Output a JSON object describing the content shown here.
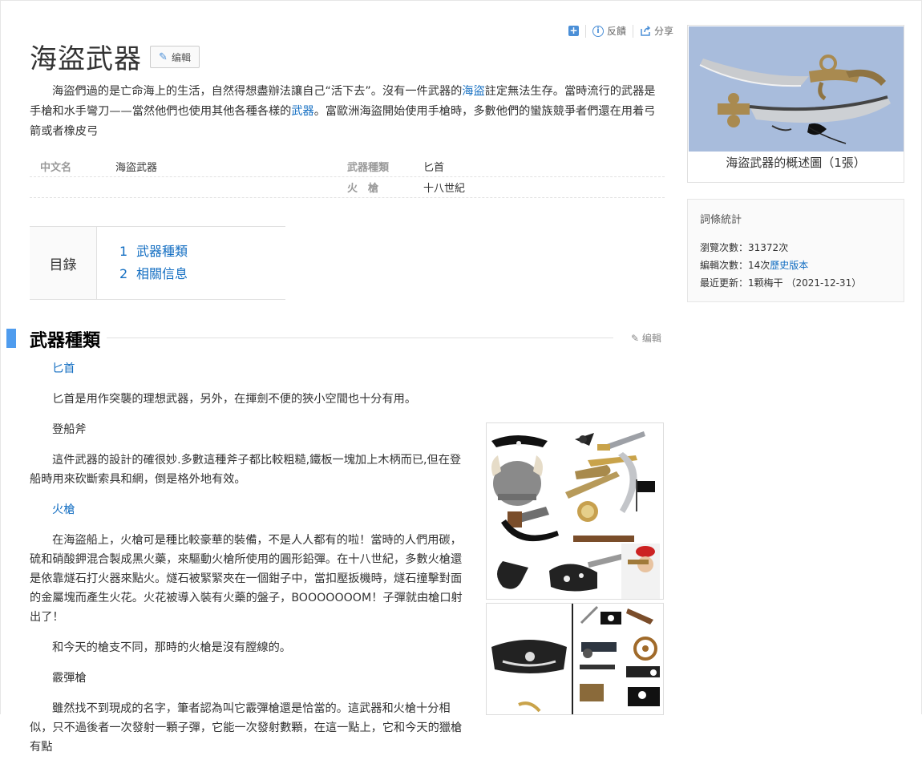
{
  "toolbar": {
    "add_icon": "plus-square-icon",
    "feedback_label": "反饋",
    "share_label": "分享"
  },
  "title": "海盜武器",
  "edit_label": "编輯",
  "intro": {
    "before_link1": "海盜們過的是亡命海上的生活，自然得想盡辦法讓自己“活下去”。沒有一件武器的",
    "link1": "海盜",
    "between": "註定無法生存。當時流行的武器是手槍和水手彎刀——當然他們也使用其他各種各樣的",
    "link2": "武器",
    "after": "。富歐洲海盜開始使用手槍時，多數他們的蠻族競爭者們還在用着弓箭或者橡皮弓"
  },
  "basic_info": {
    "row1": {
      "k1": "中文名",
      "v1": "海盜武器",
      "k2": "武器種類",
      "v2": "匕首"
    },
    "row2": {
      "k2": "火　槍",
      "v2": "十八世紀"
    }
  },
  "toc": {
    "label": "目錄",
    "items": [
      {
        "num": "1",
        "label": "武器種類"
      },
      {
        "num": "2",
        "label": "相關信息"
      }
    ]
  },
  "section": {
    "title": "武器種類",
    "edit_label": "编輯"
  },
  "body": {
    "h1": "匕首",
    "p1": "匕首是用作突襲的理想武器，另外，在揮劍不便的狹小空間也十分有用。",
    "h2": "登船斧",
    "p2": "這件武器的設計的確很妙.多數這種斧子都比較粗糙,鐵板一塊加上木柄而已,但在登船時用來砍斷索具和網，倒是格外地有效。",
    "h3": "火槍",
    "p3": "在海盜船上，火槍可是種比較豪華的裝備，不是人人都有的啦！當時的人們用碳，硫和硝酸鉀混合製成黑火藥，來驅動火槍所使用的圓形鉛彈。在十八世紀，多數火槍還是依靠燧石打火器來點火。燧石被緊緊夾在一個鉗子中，當扣壓扳機時，燧石撞擊對面的金屬塊而產生火花。火花被導入裝有火藥的盤子，BOOOOOOOM！子彈就由槍口射出了！",
    "p4": "和今天的槍支不同，那時的火槍是沒有膛線的。",
    "h5": "霰彈槍",
    "p5": "雖然找不到現成的名字，筆者認為叫它霰彈槍還是恰當的。這武器和火槍十分相似，只不過後者一次發射一顆子彈，它能一次發射數顆，在這一點上，它和今天的獵槍有點"
  },
  "album": {
    "caption": "海盜武器的概述圖（1張）"
  },
  "stats": {
    "title": "詞條統計",
    "views_label": "瀏覽次數：",
    "views_value": "31372次",
    "edits_label": "編輯次數：",
    "edits_value": "14次",
    "history_link": "歷史版本",
    "updated_label": "最近更新：",
    "updated_value": "1颗梅干 （2021-12-31）"
  }
}
